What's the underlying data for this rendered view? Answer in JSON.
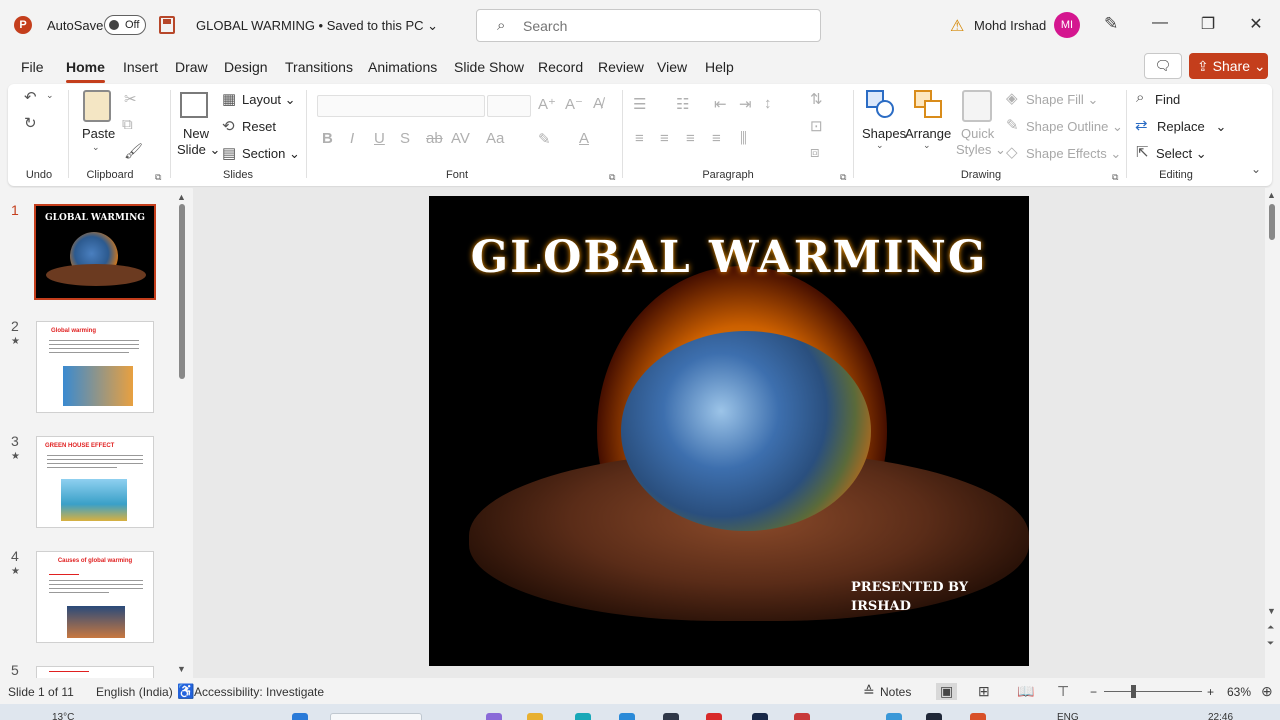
{
  "titlebar": {
    "autosave_label": "AutoSave",
    "autosave_state": "Off",
    "doc_title": "GLOBAL WARMING • Saved to this PC",
    "search_placeholder": "Search",
    "user_name": "Mohd Irshad",
    "user_initials": "MI"
  },
  "menu": {
    "tabs": [
      "File",
      "Home",
      "Insert",
      "Draw",
      "Design",
      "Transitions",
      "Animations",
      "Slide Show",
      "Record",
      "Review",
      "View",
      "Help"
    ],
    "active_tab": "Home",
    "share_label": "Share"
  },
  "ribbon": {
    "groups": {
      "undo": "Undo",
      "clipboard": "Clipboard",
      "slides": "Slides",
      "font": "Font",
      "paragraph": "Paragraph",
      "drawing": "Drawing",
      "editing": "Editing"
    },
    "paste": "Paste",
    "new_slide_1": "New",
    "new_slide_2": "Slide",
    "layout": "Layout",
    "reset": "Reset",
    "section": "Section",
    "shapes": "Shapes",
    "arrange": "Arrange",
    "quick_styles_1": "Quick",
    "quick_styles_2": "Styles",
    "shape_fill": "Shape Fill",
    "shape_outline": "Shape Outline",
    "shape_effects": "Shape Effects",
    "find": "Find",
    "replace": "Replace",
    "select": "Select"
  },
  "thumbnails": [
    {
      "number": "1",
      "title": "GLOBAL WARMING"
    },
    {
      "number": "2",
      "title": "Global warming"
    },
    {
      "number": "3",
      "title": "GREEN HOUSE EFFECT"
    },
    {
      "number": "4",
      "title": "Causes of global warming"
    },
    {
      "number": "5",
      "title": ""
    }
  ],
  "slide": {
    "title": "GLOBAL WARMING",
    "presented_by": "PRESENTED BY",
    "presenter": "IRSHAD"
  },
  "statusbar": {
    "slide_info": "Slide 1 of 11",
    "language": "English (India)",
    "accessibility": "Accessibility: Investigate",
    "notes": "Notes",
    "zoom": "63%"
  },
  "taskbar": {
    "weather": "13°C",
    "lang": "ENG",
    "time": "22:46"
  },
  "colors": {
    "accent": "#c43e1c",
    "avatar": "#d4168f"
  }
}
